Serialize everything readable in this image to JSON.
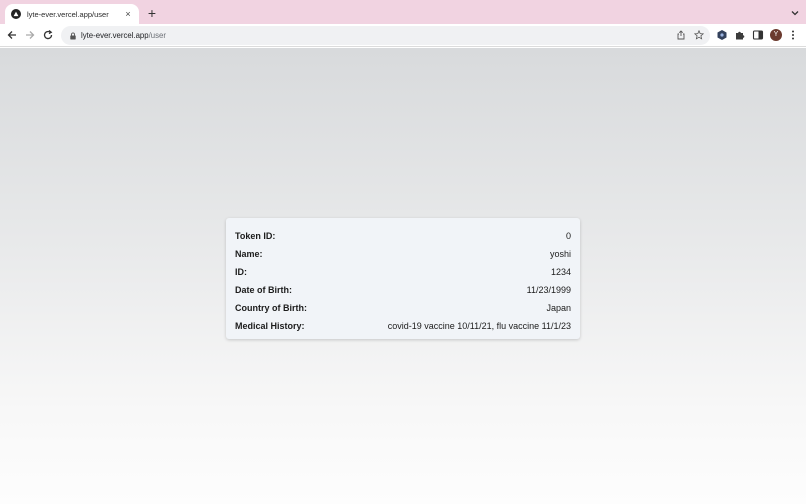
{
  "browser": {
    "tab": {
      "title": "lyte-ever.vercel.app/user",
      "close": "×"
    },
    "new_tab": "+",
    "url": {
      "host": "lyte-ever.vercel.app",
      "path": "/user"
    },
    "profile_initial": "Y"
  },
  "user_card": {
    "rows": [
      {
        "label": "Token ID:",
        "value": "0"
      },
      {
        "label": "Name:",
        "value": "yoshi"
      },
      {
        "label": "ID:",
        "value": "1234"
      },
      {
        "label": "Date of Birth:",
        "value": "11/23/1999"
      },
      {
        "label": "Country of Birth:",
        "value": "Japan"
      },
      {
        "label": "Medical History:",
        "value": "covid-19 vaccine 10/11/21, flu vaccine 11/1/23"
      }
    ]
  },
  "colors": {
    "tabstrip": "#f1d3e1",
    "card": "#f1f4f8",
    "avatar": "#6b3a2e"
  }
}
